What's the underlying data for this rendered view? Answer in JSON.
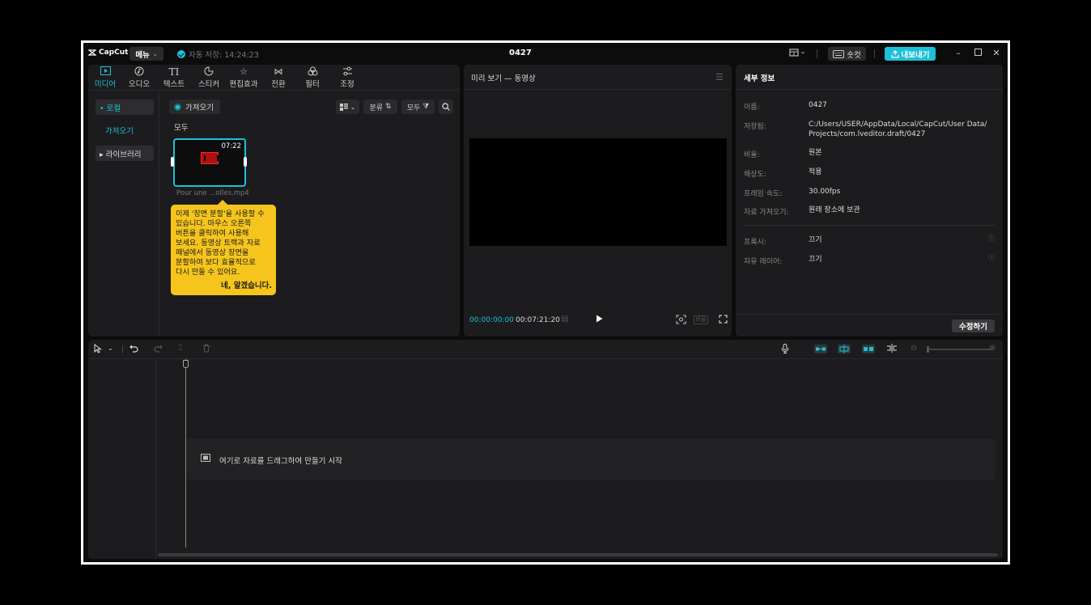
{
  "titlebar": {
    "logo": "CapCut",
    "menu_label": "메뉴",
    "autosave": "자동 저장: 14:24:23",
    "project_name": "0427",
    "shortcut_label": "숏컷",
    "export_label": "내보내기"
  },
  "media": {
    "tabs": [
      {
        "label": "미디어",
        "icon": "media-icon"
      },
      {
        "label": "오디오",
        "icon": "audio-icon"
      },
      {
        "label": "텍스트",
        "icon": "text-icon"
      },
      {
        "label": "스티커",
        "icon": "sticker-icon"
      },
      {
        "label": "편집효과",
        "icon": "effects-icon"
      },
      {
        "label": "전환",
        "icon": "transition-icon"
      },
      {
        "label": "필터",
        "icon": "filter-icon"
      },
      {
        "label": "조정",
        "icon": "adjust-icon"
      }
    ],
    "sidebar": {
      "local": "• 로컬",
      "import": "가져오기",
      "library": "▸ 라이브러리"
    },
    "import_button": "가져오기",
    "sort_label": "분류",
    "filter_label": "모두",
    "section_label": "모두",
    "clip": {
      "duration": "07:22",
      "name": "Pour une ...olles.mp4"
    },
    "tooltip": {
      "line1": "이제 '장면 분할'을 사용할 수",
      "line2": "있습니다. 마우스 오른쪽",
      "line3": "버튼을 클릭하여 사용해",
      "line4": "보세요. 동영상 트랙과 자료",
      "line5": "패널에서 동영상 장면을",
      "line6": "분할하여 보다 효율적으로",
      "line7": "다시 만들 수 있어요.",
      "ok": "네, 알겠습니다."
    }
  },
  "preview": {
    "title": "미리 보기 — 동영상",
    "current_time": "00:00:00:00",
    "total_time": "00:07:21:20",
    "ratio_label": "비율"
  },
  "details": {
    "title": "세부 정보",
    "rows": [
      {
        "label": "이름:",
        "value": "0427"
      },
      {
        "label": "저장됨:",
        "value": "C:/Users/USER/AppData/Local/CapCut/User Data/"
      },
      {
        "label": "비율:",
        "value": "원본"
      },
      {
        "label": "해상도:",
        "value": "적용"
      },
      {
        "label": "프레임 속도:",
        "value": "30.00fps"
      },
      {
        "label": "자료 가져오기:",
        "value": "원래 장소에 보관"
      },
      {
        "label": "프록시:",
        "value": "끄기"
      },
      {
        "label": "자유 레이어:",
        "value": "끄기"
      }
    ],
    "saved_path_line2": "Projects/com.lveditor.draft/0427",
    "modify_button": "수정하기"
  },
  "timeline": {
    "drop_text": "여기로 자료를 드래그하여 만들기 시작"
  },
  "colors": {
    "accent": "#1ec0d8",
    "tooltip": "#f5c51d",
    "panel": "#1c1c1e"
  }
}
